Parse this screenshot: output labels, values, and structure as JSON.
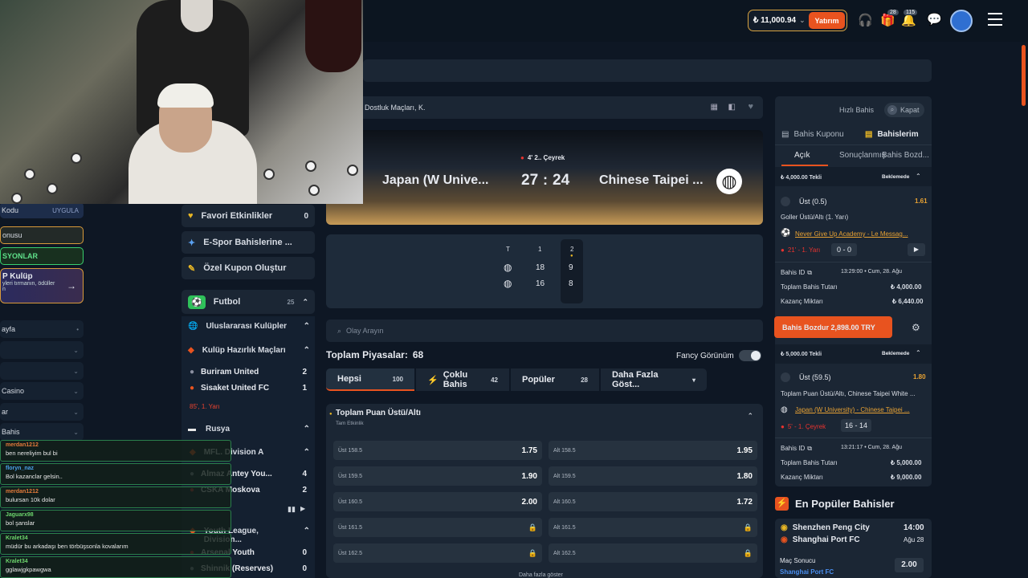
{
  "header": {
    "balance": "₺ 11,000.94",
    "deposit_label": "Yatırım",
    "gift_badge": "28",
    "bell_badge": "115"
  },
  "left_sidebar": {
    "code_label": "Kodu",
    "apply_label": "UYGULA",
    "bonus_label": "onusu",
    "promo_label": "SYONLAR",
    "club_title": "P Kulüp",
    "club_sub": "yleri tırmanın, ödüller",
    "club_sub2": "n",
    "items": [
      "ayfa",
      "",
      "",
      "Casino",
      "ar",
      "Bahis"
    ]
  },
  "chat": [
    {
      "name": "merdan1212",
      "msg": "ben nereliyim bul bi",
      "color": "#e37a3a"
    },
    {
      "name": "floryn_naz",
      "msg": "Bol kazanclar gelsin..",
      "color": "#4aa0e8"
    },
    {
      "name": "merdan1212",
      "msg": "bulursan 10k dolar",
      "color": "#e37a3a"
    },
    {
      "name": "Jaguarx98",
      "msg": "bol şanslar",
      "color": "#6dd56d"
    },
    {
      "name": "Kralet34",
      "msg": "müdür bu arkadaşı ben törbüşsonla kovalarım",
      "color": "#6dd56d"
    },
    {
      "name": "Kralet34",
      "msg": "gglawjgkpawgwa",
      "color": "#6dd56d"
    }
  ],
  "mid_sidebar": {
    "fav": {
      "label": "Favori Etkinlikler",
      "count": "0"
    },
    "esports": {
      "label": "E-Spor Bahislerine ..."
    },
    "coupon": {
      "label": "Özel Kupon Oluştur"
    },
    "football": {
      "label": "Futbol",
      "count": "25"
    },
    "intl": {
      "label": "Uluslararası Kulüpler"
    },
    "prep": {
      "label": "Kulüp Hazırlık Maçları"
    },
    "team1": {
      "name": "Buriram United",
      "score": "2"
    },
    "team2": {
      "name": "Sisaket United FC",
      "score": "1"
    },
    "match_time": "85', 1. Yarı",
    "russia": {
      "label": "Rusya"
    },
    "mfl": {
      "label": "MFL. Division A"
    },
    "team3": {
      "name": "Almaz Antey You...",
      "score": "4"
    },
    "team4": {
      "name": "CSKA Moskova",
      "score": "2"
    },
    "youth": {
      "label": "Youth League, Division..."
    },
    "team5": {
      "name": "Arsenal Youth",
      "score": "0"
    },
    "team6": {
      "name": "Shinnik (Reserves)",
      "score": "0"
    }
  },
  "match": {
    "breadcrumb": "Dostluk Maçları, K.",
    "period": "4' 2.. Çeyrek",
    "home": "Japan (W Unive...",
    "away": "Chinese Taipei ...",
    "home_score": "27",
    "away_score": "24",
    "table_headers": [
      "T",
      "1",
      "2"
    ],
    "home_quarters": [
      "18",
      "9"
    ],
    "away_quarters": [
      "16",
      "8"
    ]
  },
  "markets": {
    "search_placeholder": "Olay Arayın",
    "total_label": "Toplam Piyasalar:",
    "total_count": "68",
    "fancy_label": "Fancy Görünüm",
    "tabs": [
      {
        "label": "Hepsi",
        "count": "100"
      },
      {
        "label": "Çoklu Bahis",
        "count": "42"
      },
      {
        "label": "Popüler",
        "count": "28"
      },
      {
        "label": "Daha Fazla Göst...",
        "count": ""
      }
    ],
    "market_title": "Toplam Puan Üstü/Altı",
    "market_sub": "Tam Etkinlik",
    "odds": [
      {
        "over_label": "Üst 158.5",
        "over_odd": "1.75",
        "under_label": "Alt 158.5",
        "under_odd": "1.95"
      },
      {
        "over_label": "Üst 159.5",
        "over_odd": "1.90",
        "under_label": "Alt 159.5",
        "under_odd": "1.80"
      },
      {
        "over_label": "Üst 160.5",
        "over_odd": "2.00",
        "under_label": "Alt 160.5",
        "under_odd": "1.72"
      },
      {
        "over_label": "Üst 161.5",
        "over_odd": "",
        "under_label": "Alt 161.5",
        "under_odd": ""
      },
      {
        "over_label": "Üst 162.5",
        "over_odd": "",
        "under_label": "Alt 162.5",
        "under_odd": ""
      }
    ],
    "more_label": "Daha fazla göster"
  },
  "right_panel": {
    "quick_bet": "Hızlı Bahis",
    "close": "Kapat",
    "tab_coupon": "Bahis Kuponu",
    "tab_mybets": "Bahislerim",
    "sub_open": "Açık",
    "sub_settled": "Sonuçlanmış",
    "sub_cashout": "Bahis Bozd...",
    "bet1": {
      "stake_title": "₺ 4,000.00 Tekli",
      "status": "Beklemede",
      "selection": "Üst (0.5)",
      "odd": "1.61",
      "market": "Goller Üstü/Altı (1. Yarı)",
      "event": "Never Give Up Academy - Le Messag...",
      "live": "21' - 1. Yarı",
      "live_score": "0 - 0",
      "id_label": "Bahis ID",
      "date": "13:29:00 • Cum, 28. Ağu",
      "stake_label": "Toplam Bahis Tutarı",
      "stake": "₺ 4,000.00",
      "win_label": "Kazanç Miktarı",
      "win": "₺ 6,440.00",
      "cashout": "Bahis Bozdur 2,898.00 TRY"
    },
    "bet2": {
      "stake_title": "₺ 5,000.00 Tekli",
      "status": "Beklemede",
      "selection": "Üst (59.5)",
      "odd": "1.80",
      "market": "Toplam Puan Üstü/Altı, Chinese Taipei White ...",
      "event": "Japan (W University) - Chinese Taipei ...",
      "live": "5' - 1. Çeyrek",
      "live_score": "16 - 14",
      "id_label": "Bahis ID",
      "date": "13:21:17 • Cum, 28. Ağu",
      "stake_label": "Toplam Bahis Tutarı",
      "stake": "₺ 5,000.00",
      "win_label": "Kazanç Miktarı",
      "win": "₺ 9,000.00"
    },
    "popular_title": "En Popüler Bahisler",
    "pop_home": "Shenzhen Peng City",
    "pop_away": "Shanghai Port FC",
    "pop_time": "14:00",
    "pop_date": "Ağu 28",
    "pop_market": "Maç Sonucu",
    "pop_pick": "Shanghai Port FC",
    "pop_odd": "2.00"
  }
}
